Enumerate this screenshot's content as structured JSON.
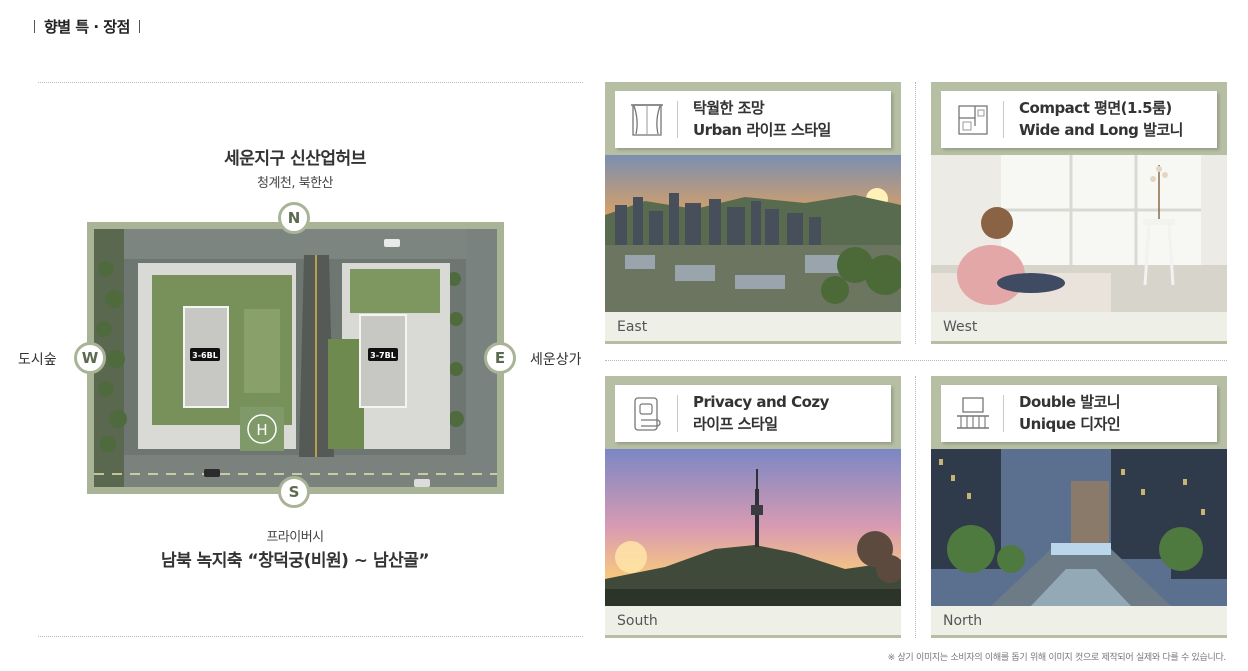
{
  "section": {
    "title": "향별 특 · 장점",
    "bar_left": "|",
    "bar_right": "|"
  },
  "map": {
    "north_title": "세운지구 신산업허브",
    "north_sub": "청계천, 북한산",
    "south_sub": "프라이버시",
    "south_title": "남북 녹지축 “창덕궁(비원) ~ 남산골”",
    "west_label": "도시숲",
    "east_label": "세운상가",
    "compass": {
      "n": "N",
      "s": "S",
      "w": "W",
      "e": "E"
    },
    "block_left": "3-6BL",
    "block_right": "3-7BL",
    "helipad": "H"
  },
  "cards": [
    {
      "line1": "탁월한 조망",
      "line2": "Urban 라이프 스타일",
      "direction": "East",
      "icon": "window-curtain-icon"
    },
    {
      "line1": "Compact 평면(1.5룸)",
      "line2": "Wide and Long 발코니",
      "direction": "West",
      "icon": "floorplan-icon"
    },
    {
      "line1": "Privacy and Cozy",
      "line2": "라이프 스타일",
      "direction": "South",
      "icon": "door-lock-icon"
    },
    {
      "line1": "Double 발코니",
      "line2": "Unique 디자인",
      "direction": "North",
      "icon": "balcony-icon"
    }
  ],
  "footnote": "※ 상기 이미지는 소비자의 이해를 돕기 위해 이미지 컷으로 제작되어 실제와 다를 수 있습니다.",
  "colors": {
    "accent": "#b6bea3",
    "compass": "#a9b497",
    "text": "#333333"
  }
}
